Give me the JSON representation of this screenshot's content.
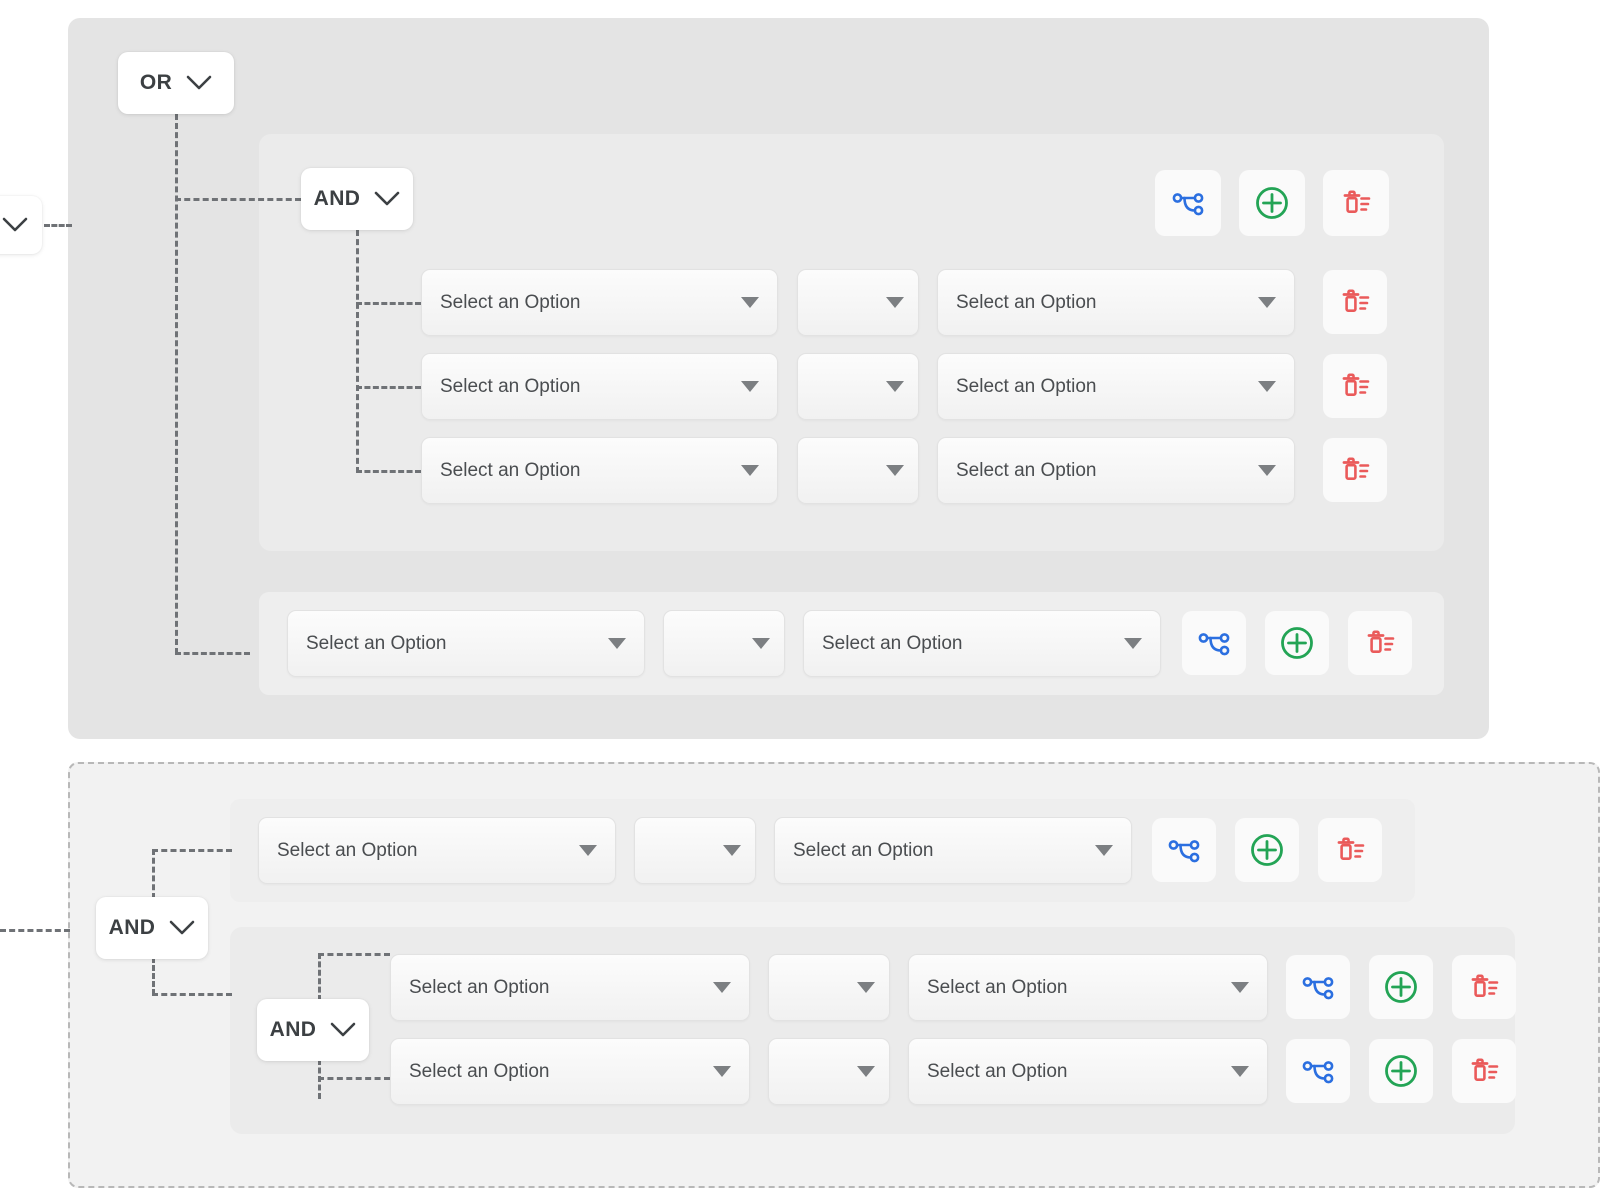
{
  "builder": {
    "select_placeholder": "Select an Option",
    "operators": {
      "or": "OR",
      "and": "AND"
    },
    "icons": {
      "branch": "branch-icon",
      "add": "add-circle-icon",
      "delete": "delete-list-icon",
      "caret": "chevron-down-icon",
      "select_caret": "dropdown-caret-icon"
    },
    "colors": {
      "branch": "#2b6fe0",
      "add": "#23a455",
      "delete": "#ea5a5a",
      "text": "#3c4043",
      "placeholder": "#4a4d50",
      "connector": "#6f7276",
      "group_outer_bg": "#e4e4e4",
      "group_mid_bg": "#ebebeb",
      "rule_band_bg": "#eeeeee",
      "dashed_group_bg": "#f2f2f2",
      "dashed_border": "#b8b8b8"
    }
  },
  "or_group": {
    "operator": "OR",
    "and_group": {
      "operator": "AND",
      "toolbar": {
        "branch": "branch-icon",
        "add": "add-circle-icon",
        "delete": "delete-list-icon"
      },
      "rules": [
        {
          "field": "Select an Option",
          "operator": "",
          "value": "Select an Option",
          "delete": "delete-list-icon"
        },
        {
          "field": "Select an Option",
          "operator": "",
          "value": "Select an Option",
          "delete": "delete-list-icon"
        },
        {
          "field": "Select an Option",
          "operator": "",
          "value": "Select an Option",
          "delete": "delete-list-icon"
        }
      ]
    },
    "rule": {
      "field": "Select an Option",
      "operator": "",
      "value": "Select an Option",
      "branch": "branch-icon",
      "add": "add-circle-icon",
      "delete": "delete-list-icon"
    }
  },
  "dashed_group": {
    "operator": "AND",
    "rule": {
      "field": "Select an Option",
      "operator": "",
      "value": "Select an Option",
      "branch": "branch-icon",
      "add": "add-circle-icon",
      "delete": "delete-list-icon"
    },
    "nested_group": {
      "operator": "AND",
      "rules": [
        {
          "field": "Select an Option",
          "operator": "",
          "value": "Select an Option",
          "branch": "branch-icon",
          "add": "add-circle-icon",
          "delete": "delete-list-icon"
        },
        {
          "field": "Select an Option",
          "operator": "",
          "value": "Select an Option",
          "branch": "branch-icon",
          "add": "add-circle-icon",
          "delete": "delete-list-icon"
        }
      ]
    }
  },
  "left_edge_connector": {
    "top_operator_caret": "chevron-down-icon"
  }
}
